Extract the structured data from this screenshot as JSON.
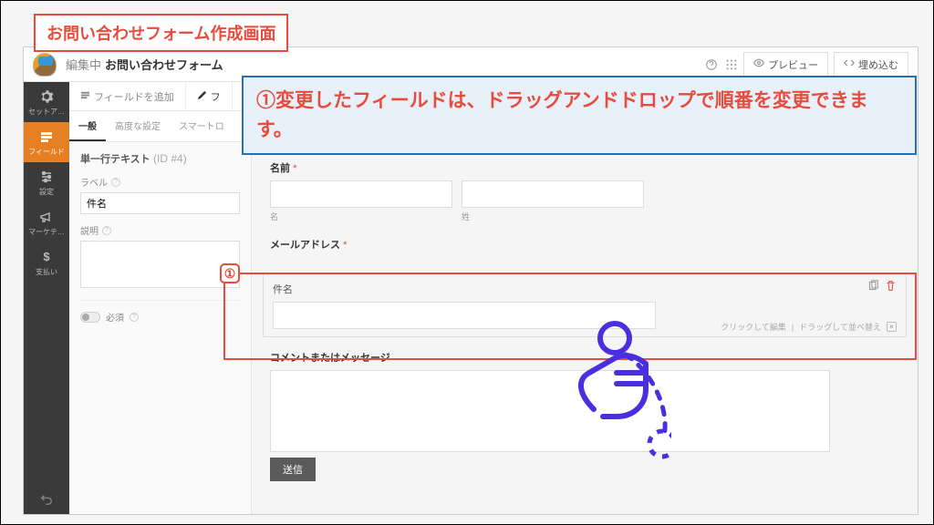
{
  "banner": "お問い合わせフォーム作成画面",
  "instruction": "①変更したフィールドは、ドラッグアンドドロップで順番を変更できます。",
  "circle": "①",
  "header": {
    "editing": "編集中",
    "title": "お問い合わせフォーム",
    "preview": "プレビュー",
    "embed": "埋め込む"
  },
  "rail": {
    "setup": "セットア…",
    "fields": "フィールド",
    "settings": "設定",
    "marketing": "マーケテ…",
    "payment": "支払い"
  },
  "settings": {
    "add_field_tab": "フィールドを追加",
    "field_tab": "フ",
    "sub_general": "一般",
    "sub_advanced": "高度な設定",
    "sub_smart": "スマートロ",
    "field_type": "単一行テキスト",
    "field_id": "(ID #4)",
    "label_label": "ラベル",
    "label_value": "件名",
    "desc_label": "説明",
    "required": "必須"
  },
  "preview": {
    "name": "名前",
    "first": "名",
    "last": "姓",
    "email": "メールアドレス",
    "subject": "件名",
    "hint_edit": "クリックして編集",
    "hint_drag": "ドラッグして並べ替え",
    "comment": "コメントまたはメッセージ",
    "submit": "送信"
  }
}
